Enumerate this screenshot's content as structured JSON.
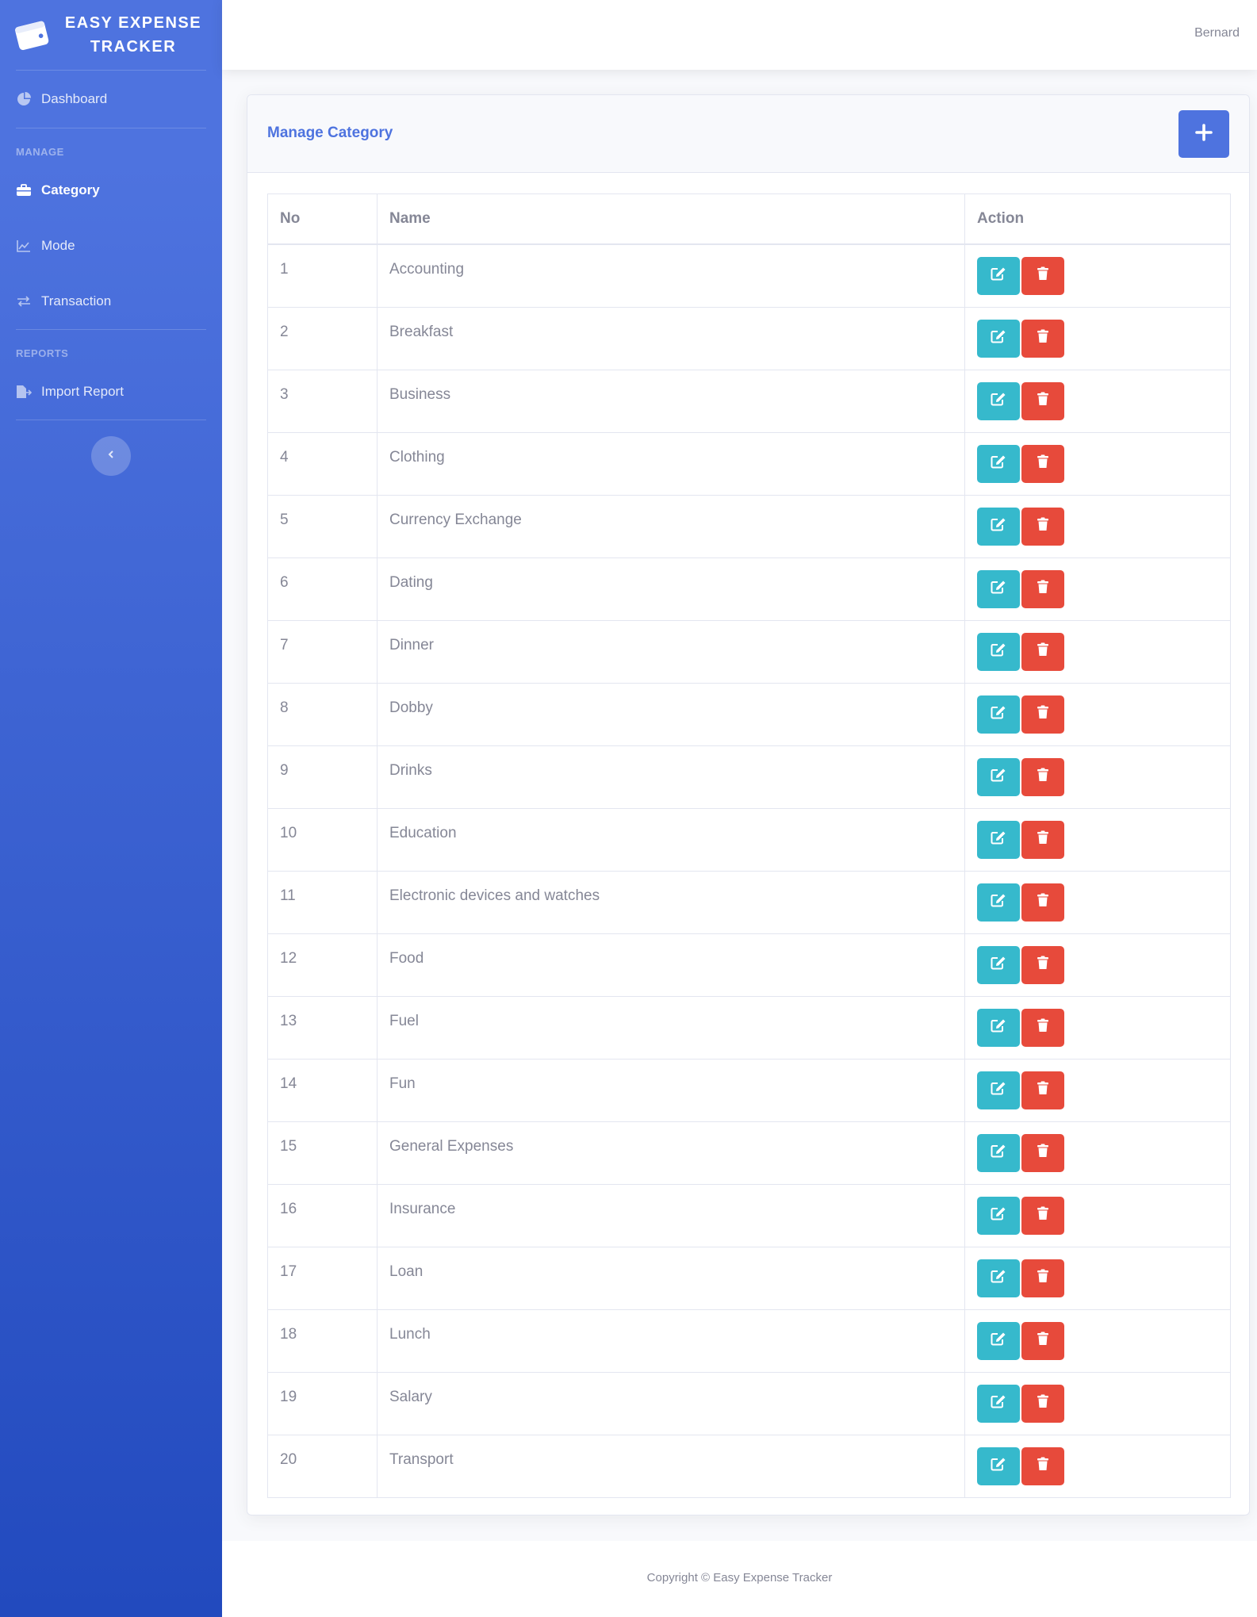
{
  "brand": {
    "line1": "EASY EXPENSE",
    "line2": "TRACKER",
    "icon": "wallet-icon"
  },
  "sidebar": {
    "dashboard": {
      "label": "Dashboard",
      "icon": "chart-pie-icon"
    },
    "manage_heading": "MANAGE",
    "category": {
      "label": "Category",
      "icon": "briefcase-icon",
      "active": true
    },
    "mode": {
      "label": "Mode",
      "icon": "chart-area-icon"
    },
    "transaction": {
      "label": "Transaction",
      "icon": "exchange-icon"
    },
    "reports_heading": "REPORTS",
    "import_report": {
      "label": "Import Report",
      "icon": "file-export-icon"
    },
    "toggle_icon": "chevron-left-icon"
  },
  "topbar": {
    "user": "Bernard"
  },
  "card": {
    "title": "Manage Category",
    "add_icon": "plus-icon"
  },
  "table": {
    "headers": [
      "No",
      "Name",
      "Action"
    ],
    "rows": [
      {
        "no": "1",
        "name": "Accounting"
      },
      {
        "no": "2",
        "name": "Breakfast"
      },
      {
        "no": "3",
        "name": "Business"
      },
      {
        "no": "4",
        "name": "Clothing"
      },
      {
        "no": "5",
        "name": "Currency Exchange"
      },
      {
        "no": "6",
        "name": "Dating"
      },
      {
        "no": "7",
        "name": "Dinner"
      },
      {
        "no": "8",
        "name": "Dobby"
      },
      {
        "no": "9",
        "name": "Drinks"
      },
      {
        "no": "10",
        "name": "Education"
      },
      {
        "no": "11",
        "name": "Electronic devices and watches"
      },
      {
        "no": "12",
        "name": "Food"
      },
      {
        "no": "13",
        "name": "Fuel"
      },
      {
        "no": "14",
        "name": "Fun"
      },
      {
        "no": "15",
        "name": "General Expenses"
      },
      {
        "no": "16",
        "name": "Insurance"
      },
      {
        "no": "17",
        "name": "Loan"
      },
      {
        "no": "18",
        "name": "Lunch"
      },
      {
        "no": "19",
        "name": "Salary"
      },
      {
        "no": "20",
        "name": "Transport"
      }
    ]
  },
  "footer": {
    "text": "Copyright © Easy Expense Tracker"
  },
  "colors": {
    "primary": "#4e73df",
    "info": "#36b9cc",
    "danger": "#e74a3b"
  }
}
